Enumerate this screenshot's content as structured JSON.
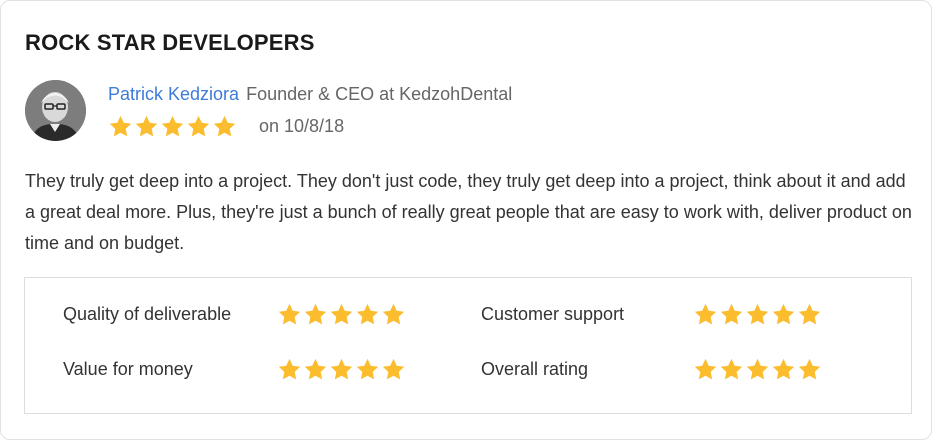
{
  "card": {
    "title": "ROCK STAR DEVELOPERS",
    "reviewer": {
      "name": "Patrick Kedziora",
      "role": "Founder & CEO at KedzohDental",
      "rating": 5,
      "date": "on 10/8/18"
    },
    "review_text": "They truly get deep into a project. They don't just code, they truly get deep into a project, think about it and add a great deal more. Plus, they're just a bunch of really great people that are easy to work with, deliver product on time and on budget.",
    "ratings": [
      {
        "label": "Quality of deliverable",
        "stars": 5
      },
      {
        "label": "Customer support",
        "stars": 5
      },
      {
        "label": "Value for money",
        "stars": 5
      },
      {
        "label": "Overall rating",
        "stars": 5
      }
    ]
  },
  "colors": {
    "star": "#fbbd2e",
    "name_link": "#3f7bd8"
  },
  "icons": {
    "star": "star-icon",
    "avatar": "reviewer-avatar"
  }
}
